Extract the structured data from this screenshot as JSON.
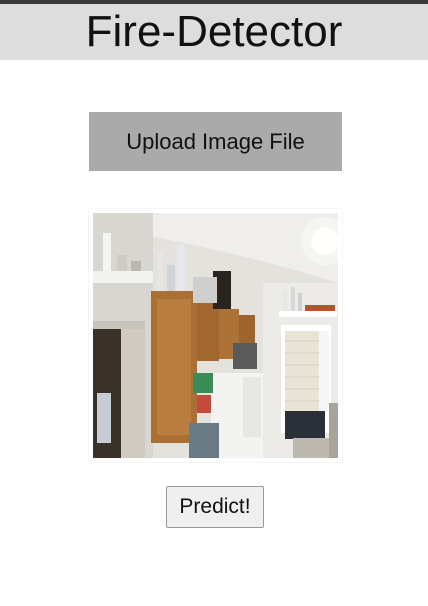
{
  "header": {
    "title": "Fire-Detector"
  },
  "upload": {
    "label": "Upload Image File"
  },
  "preview": {
    "alt": "kitchen-photo"
  },
  "predict": {
    "label": "Predict!"
  }
}
